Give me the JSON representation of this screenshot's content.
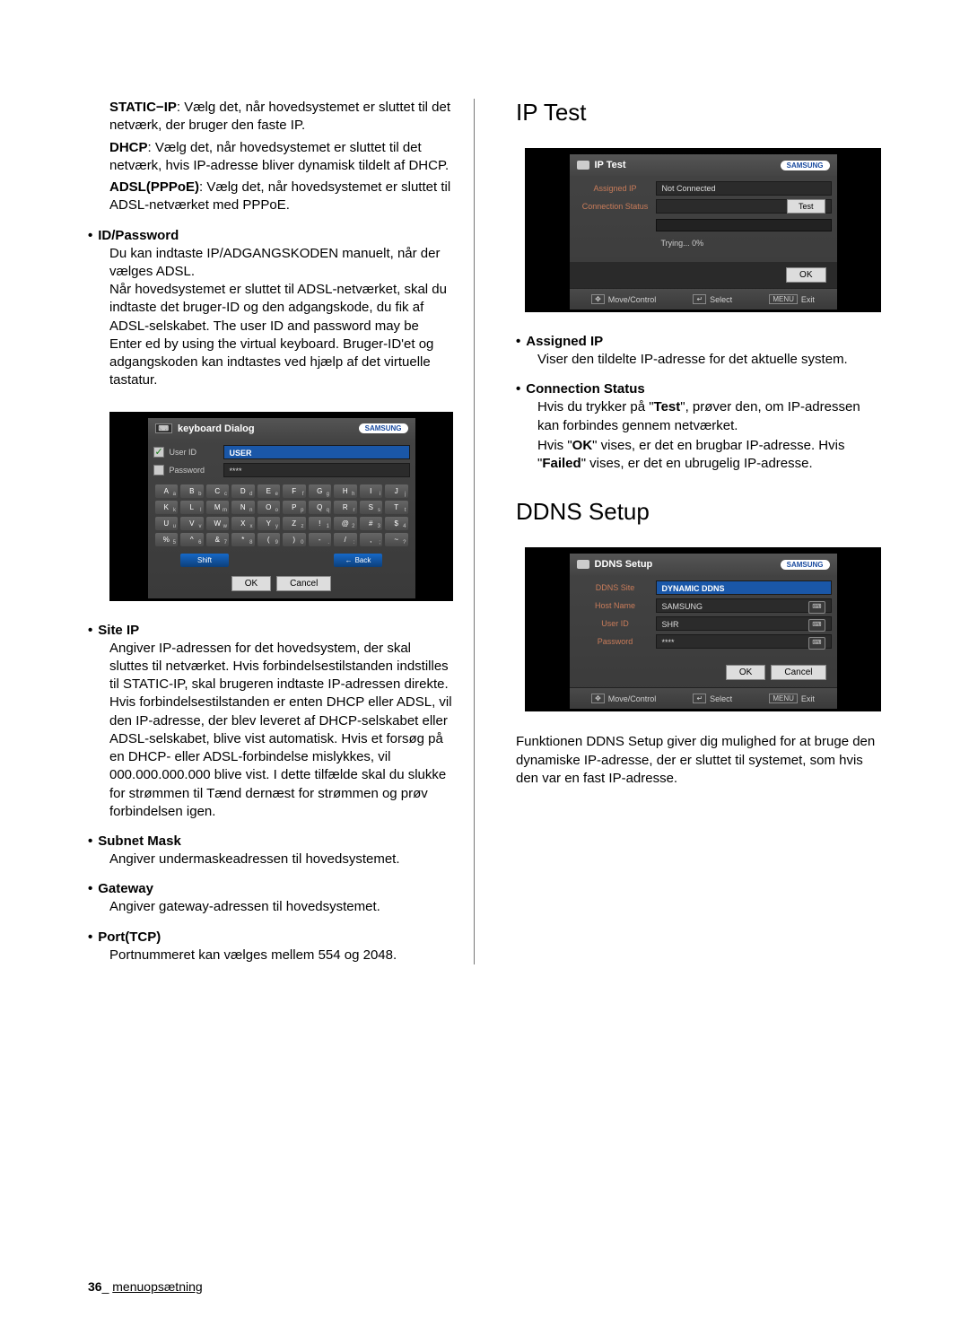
{
  "left": {
    "p1": {
      "bold": "STATIC−IP",
      "rest": ": Vælg det, når hovedsystemet er sluttet til det netværk, der bruger den faste IP."
    },
    "p2": {
      "bold": "DHCP",
      "rest": ": Vælg det, når hovedsystemet er sluttet til det netværk, hvis IP-adresse bliver dynamisk tildelt af DHCP."
    },
    "p3": {
      "bold": "ADSL(PPPoE)",
      "rest": ": Vælg det, når hovedsystemet er sluttet til ADSL-netværket med PPPoE."
    },
    "idpw": {
      "title": "ID/Password",
      "body": "Du kan indtaste IP/ADGANGSKODEN manuelt, når der vælges ADSL.\nNår hovedsystemet er sluttet til ADSL-netværket, skal du indtaste det bruger-ID og den adgangskode, du fik af ADSL-selskabet. The user ID and password may be Enter ed by using the virtual keyboard. Bruger-ID'et og adgangskoden kan indtastes ved hjælp af det virtuelle tastatur."
    },
    "keyboard": {
      "title": "keyboard Dialog",
      "brand": "SAMSUNG",
      "userid_label": "User ID",
      "userid_value": "USER",
      "password_label": "Password",
      "password_value": "****",
      "keys_r1": [
        [
          "A",
          "a"
        ],
        [
          "B",
          "b"
        ],
        [
          "C",
          "c"
        ],
        [
          "D",
          "d"
        ],
        [
          "E",
          "e"
        ],
        [
          "F",
          "f"
        ],
        [
          "G",
          "g"
        ],
        [
          "H",
          "h"
        ],
        [
          "I",
          "i"
        ],
        [
          "J",
          "j"
        ]
      ],
      "keys_r2": [
        [
          "K",
          "k"
        ],
        [
          "L",
          "l"
        ],
        [
          "M",
          "m"
        ],
        [
          "N",
          "n"
        ],
        [
          "O",
          "o"
        ],
        [
          "P",
          "p"
        ],
        [
          "Q",
          "q"
        ],
        [
          "R",
          "r"
        ],
        [
          "S",
          "s"
        ],
        [
          "T",
          "t"
        ]
      ],
      "keys_r3": [
        [
          "U",
          "u"
        ],
        [
          "V",
          "v"
        ],
        [
          "W",
          "w"
        ],
        [
          "X",
          "x"
        ],
        [
          "Y",
          "y"
        ],
        [
          "Z",
          "z"
        ],
        [
          "!",
          "1"
        ],
        [
          "@",
          "2"
        ],
        [
          "#",
          "3"
        ],
        [
          "$",
          "4"
        ]
      ],
      "keys_r4": [
        [
          "%",
          "5"
        ],
        [
          "^",
          "6"
        ],
        [
          "&",
          "7"
        ],
        [
          "*",
          "8"
        ],
        [
          "(",
          "9"
        ],
        [
          ")",
          "0"
        ],
        [
          "-",
          "."
        ],
        [
          "/",
          ":"
        ],
        [
          ",",
          ";"
        ],
        [
          "~",
          "?"
        ]
      ],
      "shift": "Shift",
      "back": "Back",
      "ok": "OK",
      "cancel": "Cancel"
    },
    "siteip": {
      "title": "Site IP",
      "body": "Angiver IP-adressen for det hovedsystem, der skal sluttes til netværket. Hvis forbindelsestilstanden indstilles til STATIC-IP, skal brugeren indtaste IP-adressen direkte.\nHvis forbindelsestilstanden er enten DHCP eller ADSL, vil den IP-adresse, der blev leveret af DHCP-selskabet eller ADSL-selskabet, blive vist automatisk. Hvis et forsøg på en DHCP- eller ADSL-forbindelse mislykkes, vil 000.000.000.000 blive vist. I dette tilfælde skal du slukke for strømmen til Tænd dernæst for strømmen og prøv forbindelsen igen."
    },
    "subnet": {
      "title": "Subnet Mask",
      "body": "Angiver undermaskeadressen til hovedsystemet."
    },
    "gateway": {
      "title": "Gateway",
      "body": "Angiver gateway-adressen til hovedsystemet."
    },
    "port": {
      "title": "Port(TCP)",
      "body": "Portnummeret kan vælges mellem 554 og 2048."
    }
  },
  "right": {
    "iptest": {
      "title": "IP Test",
      "panel_title": "IP Test",
      "brand": "SAMSUNG",
      "assigned_label": "Assigned IP",
      "assigned_value": "Not Connected",
      "connstat_label": "Connection Status",
      "test": "Test",
      "progress": "Trying... 0%",
      "ok": "OK",
      "footer_move": "Move/Control",
      "footer_select": "Select",
      "footer_exit": "Exit",
      "assigned_bullet": "Assigned IP",
      "assigned_body": "Viser den tildelte IP-adresse for det aktuelle system.",
      "conn_bullet": "Connection Status",
      "conn_body1_a": "Hvis du trykker på \"",
      "conn_body1_b": "Test",
      "conn_body1_c": "\", prøver den, om IP-adressen kan forbindes gennem netværket.",
      "conn_body2_a": "Hvis \"",
      "conn_body2_b": "OK",
      "conn_body2_c": "\" vises, er det en brugbar IP-adresse. Hvis \"",
      "conn_body2_d": "Failed",
      "conn_body2_e": "\" vises, er det en ubrugelig IP-adresse."
    },
    "ddns": {
      "title": "DDNS Setup",
      "panel_title": "DDNS Setup",
      "brand": "SAMSUNG",
      "site_label": "DDNS Site",
      "site_value": "DYNAMIC DDNS",
      "host_label": "Host Name",
      "host_value": "SAMSUNG",
      "user_label": "User ID",
      "user_value": "SHR",
      "pass_label": "Password",
      "pass_value": "****",
      "ok": "OK",
      "cancel": "Cancel",
      "footer_move": "Move/Control",
      "footer_select": "Select",
      "footer_exit": "Exit",
      "desc": "Funktionen DDNS Setup giver dig mulighed for at bruge den dynamiske IP-adresse, der er sluttet til systemet, som hvis den var en fast IP-adresse."
    }
  },
  "footer": {
    "page": "36",
    "sep": "_",
    "text": "menuopsætning"
  },
  "labels": {
    "enter": "↵",
    "menu": "MENU",
    "arrow_left": "←"
  }
}
